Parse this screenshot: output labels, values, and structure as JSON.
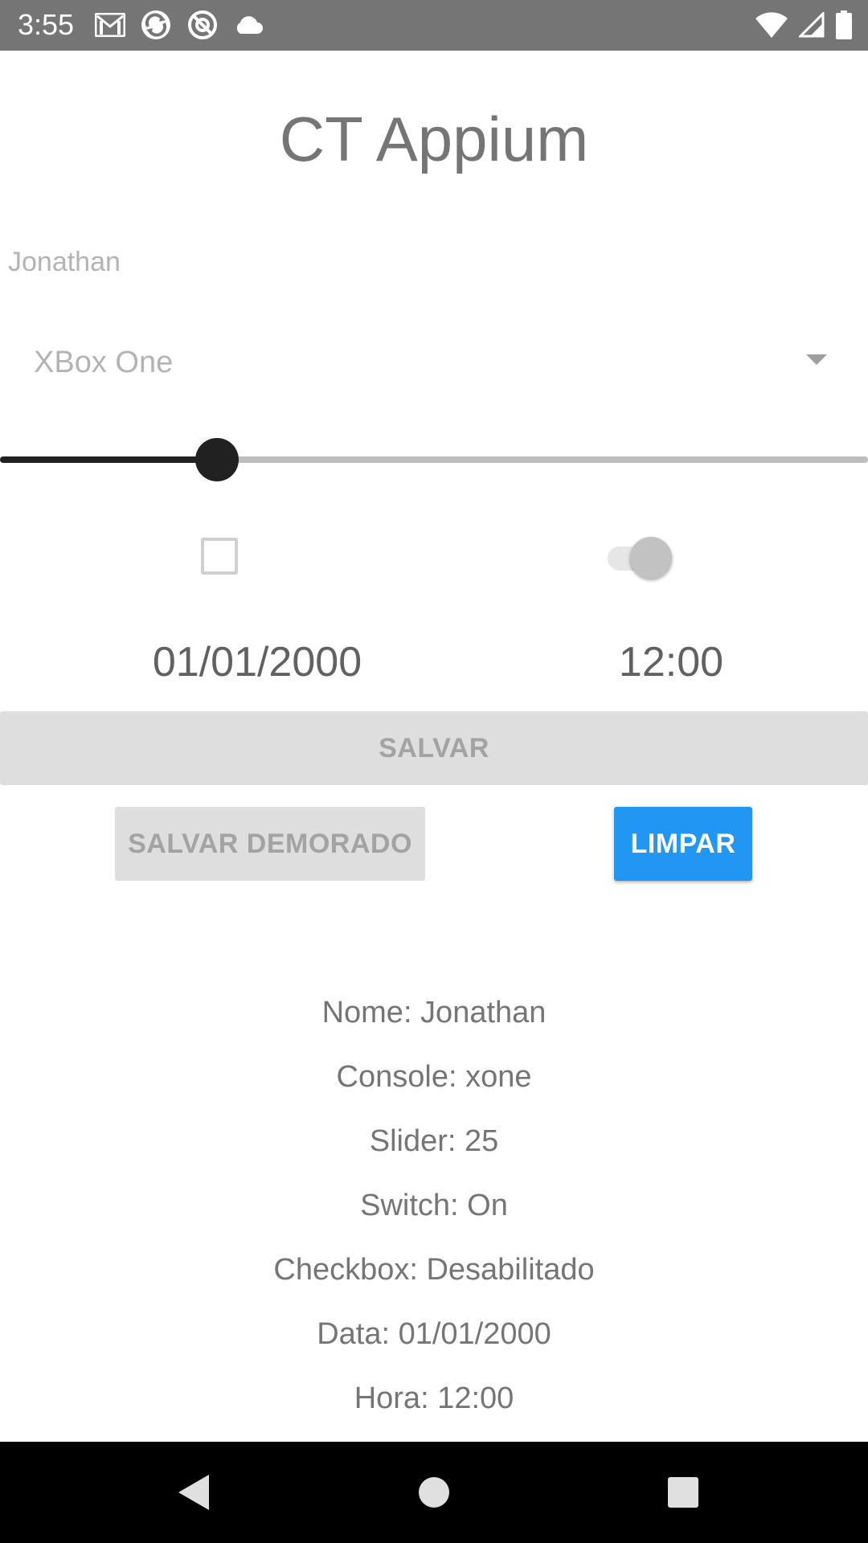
{
  "status_bar": {
    "time": "3:55",
    "left_icons": [
      "gmail-icon",
      "sync-icon",
      "no-disturb-icon",
      "cloud-icon"
    ],
    "right_icons": [
      "wifi-icon",
      "signal-icon",
      "battery-icon"
    ],
    "background": "#757575"
  },
  "app": {
    "title": "CT Appium"
  },
  "form": {
    "name_value": "Jonathan",
    "console_selected": "XBox One",
    "slider_value_percent": 25,
    "checkbox_checked": false,
    "switch_on": true,
    "date": "01/01/2000",
    "time": "12:00"
  },
  "buttons": {
    "save_label": "SALVAR",
    "save_delayed_label": "SALVAR DEMORADO",
    "clear_label": "LIMPAR",
    "clear_color": "#2196f3"
  },
  "results": {
    "nome": "Nome: Jonathan",
    "console": "Console: xone",
    "slider": "Slider: 25",
    "switch": "Switch: On",
    "checkbox": "Checkbox: Desabilitado",
    "data": "Data: 01/01/2000",
    "hora": "Hora: 12:00"
  },
  "nav_bar": {
    "icons": [
      "back-icon",
      "home-icon",
      "recents-icon"
    ]
  }
}
